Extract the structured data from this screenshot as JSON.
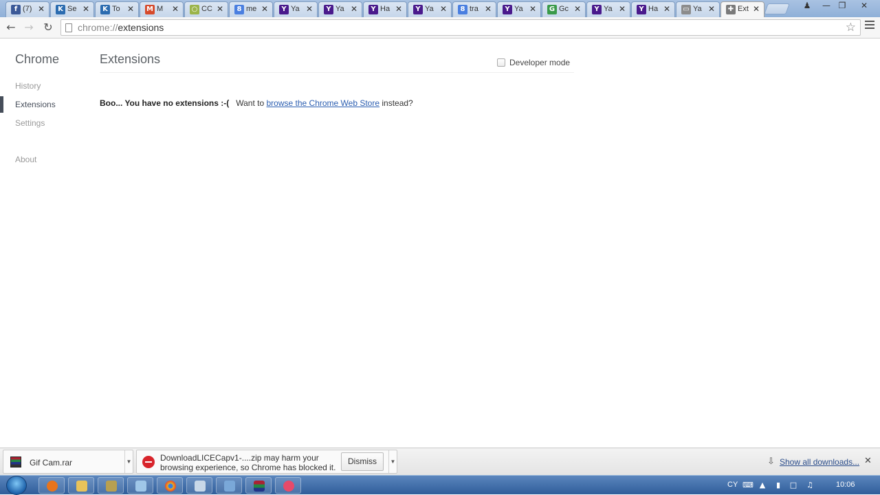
{
  "tabs": [
    {
      "title": "(7)",
      "favicon": "facebook-icon",
      "color": "#3b5998",
      "glyph": "f"
    },
    {
      "title": "Se",
      "favicon": "k-icon",
      "color": "#2b6cb0",
      "glyph": "K"
    },
    {
      "title": "To",
      "favicon": "k-icon",
      "color": "#2b6cb0",
      "glyph": "K"
    },
    {
      "title": "M",
      "favicon": "maps-icon",
      "color": "#d64a2b",
      "glyph": "M"
    },
    {
      "title": "CC",
      "favicon": "drop-icon",
      "color": "#9bb44a",
      "glyph": "○"
    },
    {
      "title": "me",
      "favicon": "google-icon",
      "color": "#4a7fe0",
      "glyph": "8"
    },
    {
      "title": "Ya",
      "favicon": "yahoo-icon",
      "color": "#4a1a8c",
      "glyph": "Y"
    },
    {
      "title": "Ya",
      "favicon": "yahoo-icon",
      "color": "#4a1a8c",
      "glyph": "Y"
    },
    {
      "title": "Ha",
      "favicon": "yahoo-icon",
      "color": "#4a1a8c",
      "glyph": "Y"
    },
    {
      "title": "Ya",
      "favicon": "yahoo-icon",
      "color": "#4a1a8c",
      "glyph": "Y"
    },
    {
      "title": "tra",
      "favicon": "google-icon",
      "color": "#4a7fe0",
      "glyph": "8"
    },
    {
      "title": "Ya",
      "favicon": "yahoo-icon",
      "color": "#4a1a8c",
      "glyph": "Y"
    },
    {
      "title": "Gc",
      "favicon": "maps-icon",
      "color": "#3a9a4a",
      "glyph": "G"
    },
    {
      "title": "Ya",
      "favicon": "yahoo-icon",
      "color": "#4a1a8c",
      "glyph": "Y"
    },
    {
      "title": "Ha",
      "favicon": "yahoo-icon",
      "color": "#4a1a8c",
      "glyph": "Y"
    },
    {
      "title": "Ya",
      "favicon": "folder-icon",
      "color": "#8c8c8c",
      "glyph": "▭"
    },
    {
      "title": "Ext",
      "favicon": "puzzle-icon",
      "color": "#7a7a7a",
      "glyph": "✚",
      "active": true
    }
  ],
  "toolbar": {
    "url_scheme": "chrome://",
    "url_path": "extensions"
  },
  "sidebar": {
    "title": "Chrome",
    "items": [
      {
        "label": "History"
      },
      {
        "label": "Extensions",
        "selected": true
      },
      {
        "label": "Settings"
      },
      {
        "label": "About"
      }
    ]
  },
  "main": {
    "title": "Extensions",
    "developer_mode_label": "Developer mode",
    "empty_bold": "Boo... You have no extensions :-(",
    "empty_prefix": "Want to ",
    "empty_link": "browse the Chrome Web Store",
    "empty_suffix": " instead?"
  },
  "download_shelf": {
    "item1_name": "Gif Cam.rar",
    "item2_line1": "DownloadLICECapv1-....zip may harm your",
    "item2_line2": "browsing experience, so Chrome has blocked it.",
    "dismiss_label": "Dismiss",
    "show_all_label": "Show all downloads..."
  },
  "taskbar": {
    "language": "CY",
    "clock": "10:06"
  },
  "colors": {
    "link": "#2a5db0",
    "nav_selected": "#464e5a",
    "taskbar": "#2f5d9a"
  }
}
